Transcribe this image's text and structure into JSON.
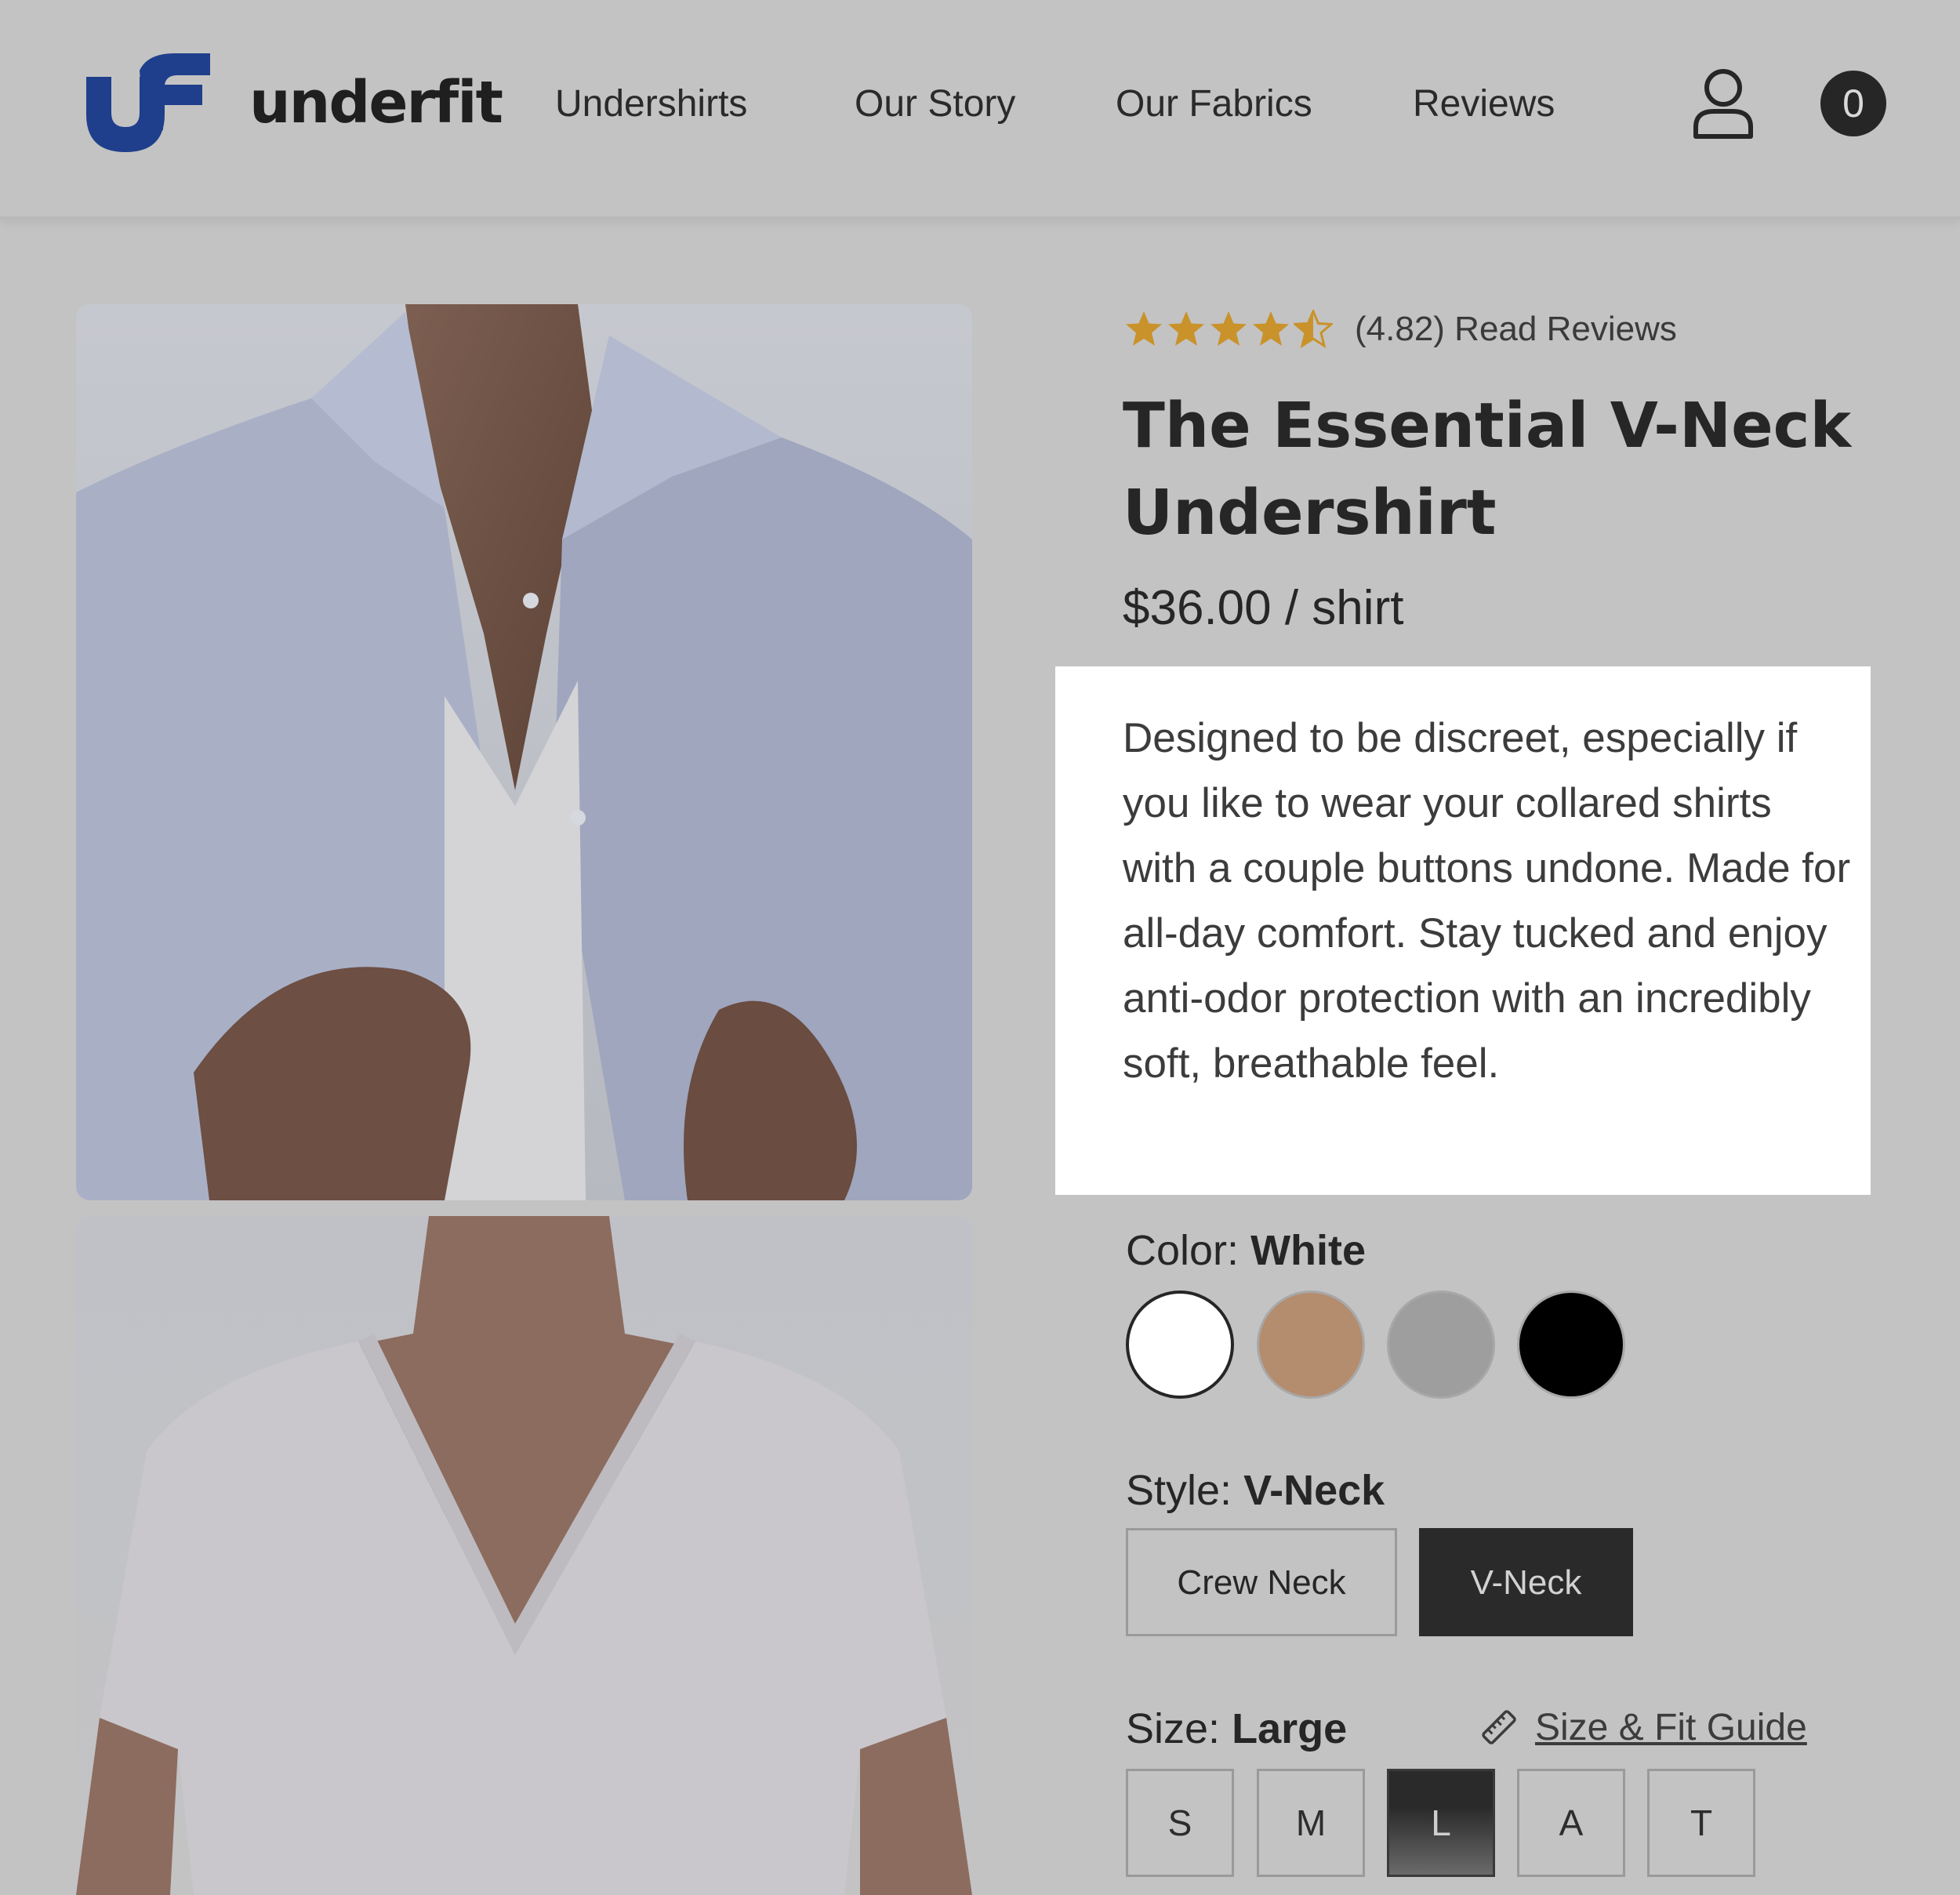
{
  "header": {
    "brand": "underfit",
    "nav": [
      "Undershirts",
      "Our Story",
      "Our Fabrics",
      "Reviews"
    ],
    "cart_count": "0",
    "icons": {
      "logo": "uf-logo-icon",
      "account": "user-icon"
    }
  },
  "product": {
    "rating_value": 4.82,
    "rating_text": "(4.82) Read Reviews",
    "title": "The Essential V-Neck Undershirt",
    "price": "$36.00 / shirt",
    "description": "Designed to be discreet, especially if you like to wear your collared shirts with a couple buttons undone. Made for all-day comfort. Stay tucked and enjoy anti-odor protection with an incredibly soft, breathable feel."
  },
  "color": {
    "label": "Color:",
    "selected": "White",
    "swatches": [
      {
        "name": "white",
        "hex": "#ffffff"
      },
      {
        "name": "tan",
        "hex": "#b48c6e"
      },
      {
        "name": "gray",
        "hex": "#9e9e9e"
      },
      {
        "name": "black",
        "hex": "#000000"
      }
    ]
  },
  "style": {
    "label": "Style:",
    "selected": "V-Neck",
    "options": [
      "Crew Neck",
      "V-Neck"
    ]
  },
  "size": {
    "label": "Size:",
    "selected": "Large",
    "guide_label": "Size & Fit Guide",
    "options": [
      "S",
      "M",
      "L",
      "A",
      "T"
    ]
  },
  "colors": {
    "brand_blue": "#1f3f8c",
    "star_gold": "#c9922a",
    "overlay_gray": "#c3c3c3"
  }
}
